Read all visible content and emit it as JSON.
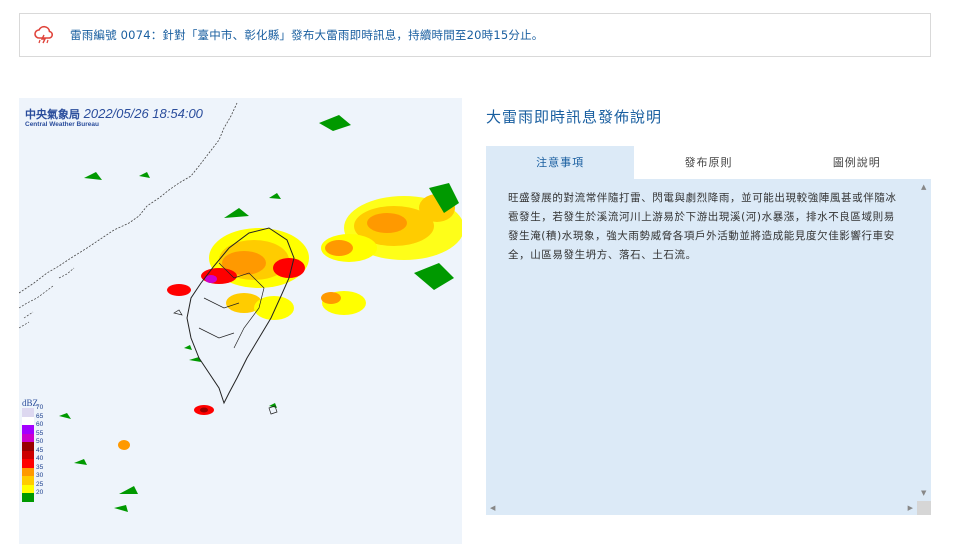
{
  "alert": {
    "icon": "thunderstorm-cloud-icon",
    "text": "雷雨編號 0074：針對「臺中市、彰化縣」發布大雷雨即時訊息，持續時間至20時15分止。",
    "icon_color": "#e0433a"
  },
  "radar": {
    "agency": "中央氣象局",
    "timestamp": "2022/05/26 18:54:00",
    "agency_en": "Central Weather Bureau",
    "legend_title": "dBZ",
    "legend": [
      {
        "label": "70",
        "color": "#ddd8f0"
      },
      {
        "label": "65",
        "color": "#ffffff"
      },
      {
        "label": "60",
        "color": "#a300ff"
      },
      {
        "label": "55",
        "color": "#cc00cc"
      },
      {
        "label": "50",
        "color": "#990000"
      },
      {
        "label": "45",
        "color": "#cc0000"
      },
      {
        "label": "40",
        "color": "#ff0000"
      },
      {
        "label": "35",
        "color": "#ff9900"
      },
      {
        "label": "30",
        "color": "#ffcc00"
      },
      {
        "label": "25",
        "color": "#ffff00"
      },
      {
        "label": "20",
        "color": "#009900"
      }
    ]
  },
  "panel": {
    "title": "大雷雨即時訊息發佈說明",
    "tabs": [
      {
        "label": "注意事項",
        "active": true
      },
      {
        "label": "發布原則",
        "active": false
      },
      {
        "label": "圖例說明",
        "active": false
      }
    ],
    "content": "旺盛發展的對流常伴隨打雷、閃電與劇烈降雨，並可能出現較強陣風甚或伴隨冰雹發生，若發生於溪流河川上游易於下游出現溪(河)水暴漲，排水不良區域則易發生淹(積)水現象，強大雨勢威脅各項戶外活動並將造成能見度欠佳影響行車安全，山區易發生坍方、落石、土石流。"
  },
  "colors": {
    "accent": "#1a5fa0",
    "tab_active_bg": "#dceaf7"
  }
}
